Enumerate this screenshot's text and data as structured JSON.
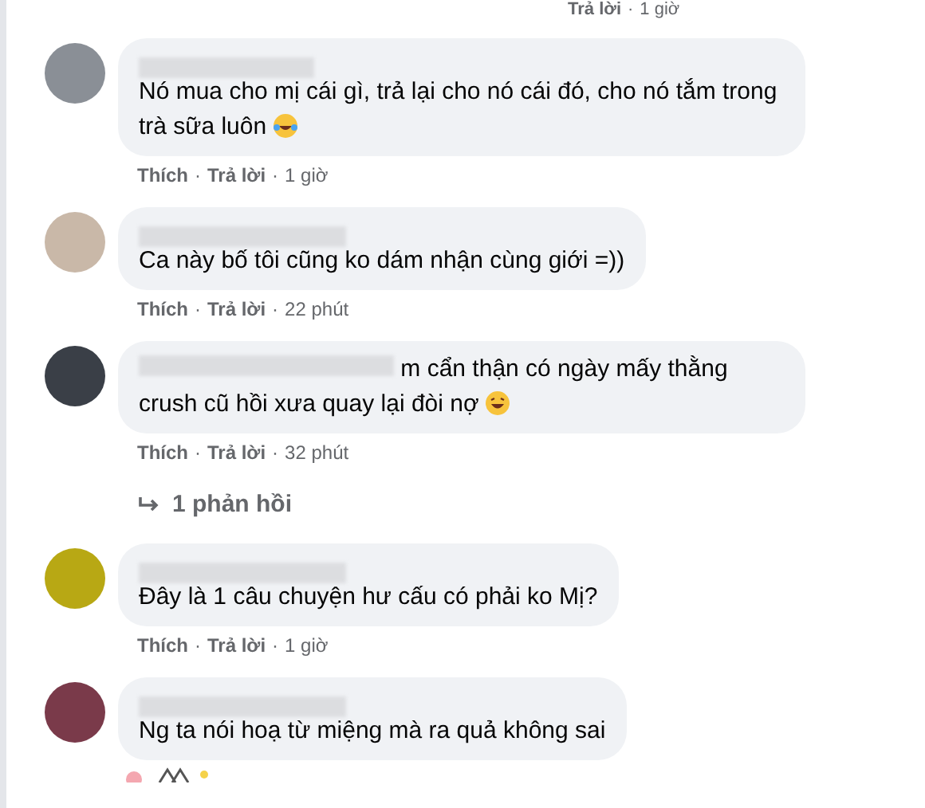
{
  "top_meta": {
    "reply": "Trả lời",
    "sep": "·",
    "time": "1 giờ"
  },
  "comments": [
    {
      "text": "Nó mua cho mị cái gì, trả lại cho nó cái đó, cho nó tắm trong trà sữa luôn",
      "emoji": {
        "kind": "tears"
      },
      "name_inline": false,
      "like": "Thích",
      "sep": "·",
      "reply": "Trả lời",
      "time": "1 giờ"
    },
    {
      "text": "Ca này bố tôi cũng ko dám nhận cùng giới =))",
      "name_inline": false,
      "like": "Thích",
      "sep": "·",
      "reply": "Trả lời",
      "time": "22 phút"
    },
    {
      "text": "m cẩn thận có ngày mấy thằng crush cũ hồi xưa quay lại đòi nợ",
      "emoji": {
        "kind": "grin"
      },
      "name_inline": true,
      "like": "Thích",
      "sep": "·",
      "reply": "Trả lời",
      "time": "32 phút",
      "replies": "1 phản hồi"
    },
    {
      "text": "Đây là 1 câu chuyện hư cấu có phải ko Mị?",
      "name_inline": false,
      "like": "Thích",
      "sep": "·",
      "reply": "Trả lời",
      "time": "1 giờ"
    },
    {
      "text": "Ng ta nói hoạ từ miệng mà ra quả không sai",
      "name_inline": false
    }
  ]
}
